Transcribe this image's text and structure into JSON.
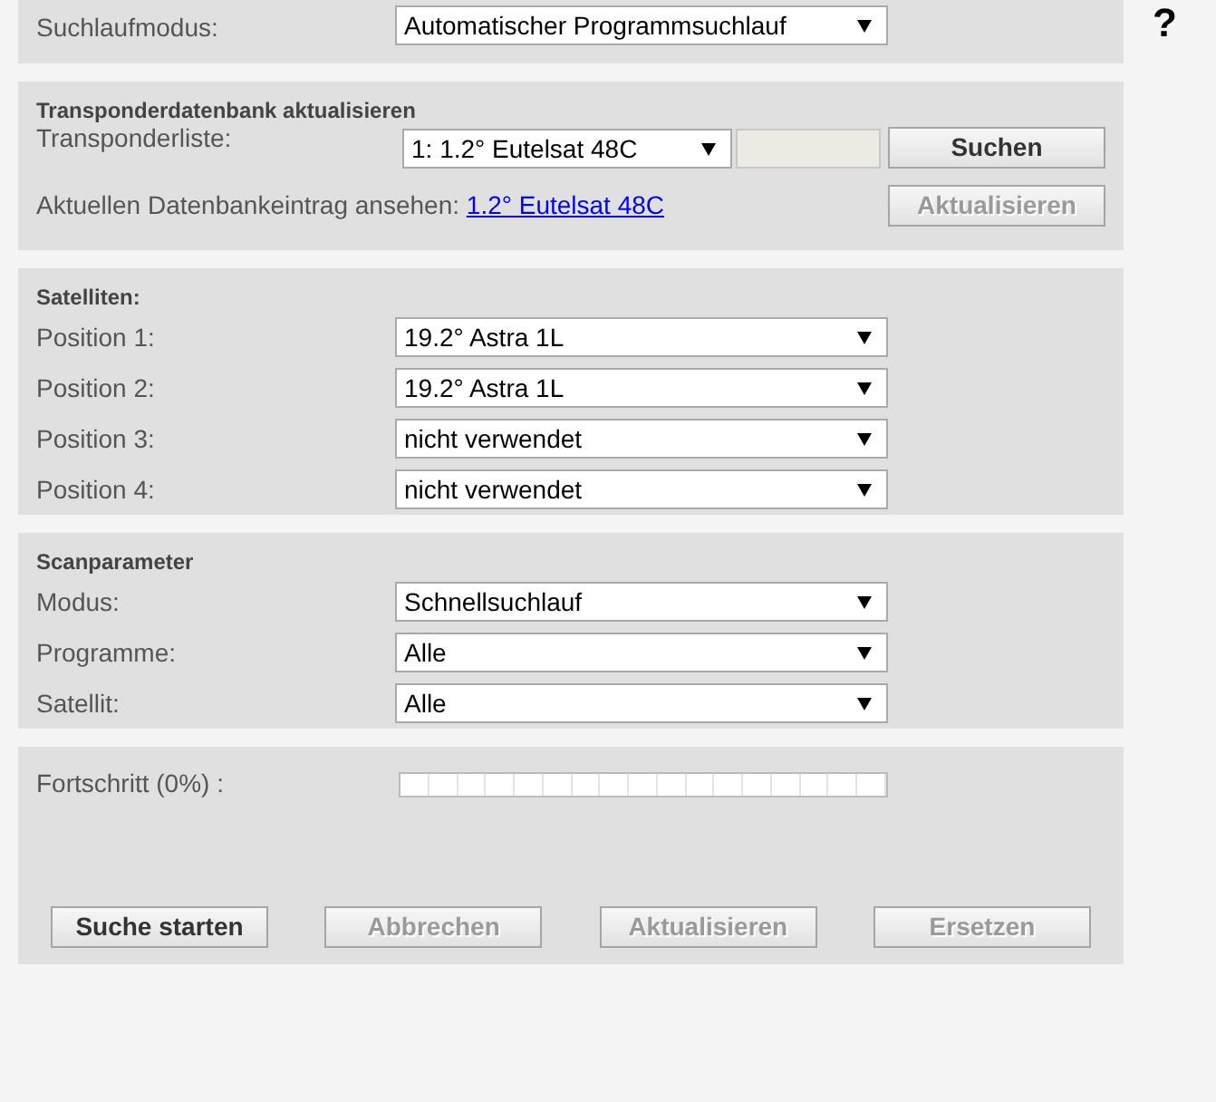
{
  "help": "?",
  "search_mode": {
    "label": "Suchlaufmodus:",
    "value": "Automatischer Programmsuchlauf"
  },
  "transponder": {
    "title": "Transponderdatenbank aktualisieren",
    "list_label": "Transponderliste:",
    "list_value": "1: 1.2° Eutelsat 48C",
    "search_button": {
      "label": "Suchen",
      "disabled": false
    },
    "view_label": "Aktuellen Datenbankeintrag ansehen:",
    "view_link": "1.2° Eutelsat 48C",
    "update_button": {
      "label": "Aktualisieren",
      "disabled": true
    }
  },
  "satellites": {
    "title": "Satelliten:",
    "rows": [
      {
        "label": "Position 1:",
        "value": "19.2° Astra 1L"
      },
      {
        "label": "Position 2:",
        "value": "19.2° Astra 1L"
      },
      {
        "label": "Position 3:",
        "value": "nicht verwendet"
      },
      {
        "label": "Position 4:",
        "value": "nicht verwendet"
      }
    ]
  },
  "scan": {
    "title": "Scanparameter",
    "rows": [
      {
        "label": "Modus:",
        "value": "Schnellsuchlauf"
      },
      {
        "label": "Programme:",
        "value": "Alle"
      },
      {
        "label": "Satellit:",
        "value": "Alle"
      }
    ]
  },
  "progress": {
    "label": "Fortschritt (0%) :",
    "level": 0
  },
  "buttons": [
    {
      "label": "Suche starten",
      "disabled": false
    },
    {
      "label": "Abbrechen",
      "disabled": true
    },
    {
      "label": "Aktualisieren",
      "disabled": true
    },
    {
      "label": "Ersetzen",
      "disabled": true
    }
  ]
}
